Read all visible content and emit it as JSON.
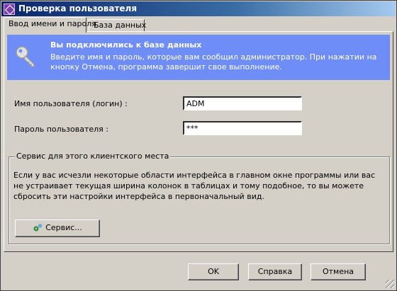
{
  "window": {
    "title": "Проверка пользователя"
  },
  "tabs": [
    {
      "label": "Ввод имени и пароля",
      "active": true
    },
    {
      "label": "База данных",
      "active": false
    }
  ],
  "banner": {
    "title": "Вы подключились к базе данных",
    "text": "Введите имя и пароль, которые вам сообщил администратор. При нажатии на кнопку Отмена, программа завершит свое выполнение.",
    "icon": "key-icon",
    "background": "#6f8df6"
  },
  "form": {
    "username_label": "Имя пользователя (логин) :",
    "username_value": "ADM",
    "password_label": "Пароль пользователя :",
    "password_value": "***"
  },
  "service_group": {
    "title": "Сервис для этого клиентского места",
    "text": "Если у вас исчезли некоторые области интерфейса в главном окне программы или вас не устраивает текущая ширина колонок в таблицах и тому подобное, то вы можете сбросить эти настройки интерфейса в первоначальный вид.",
    "button_label": "Сервис...",
    "button_icon": "gear-icon"
  },
  "footer": {
    "ok_label": "OK",
    "help_label": "Справка",
    "cancel_label": "Отмена"
  }
}
